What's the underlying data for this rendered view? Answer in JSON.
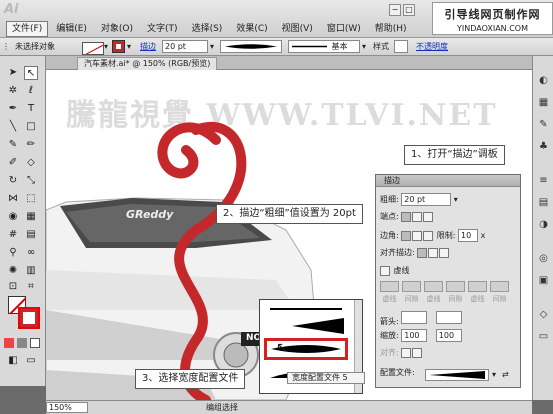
{
  "app": {
    "logo": "Ai"
  },
  "menu": {
    "items": [
      "文件(F)",
      "编辑(E)",
      "对象(O)",
      "文字(T)",
      "选择(S)",
      "效果(C)",
      "视图(V)",
      "窗口(W)",
      "帮助(H)"
    ]
  },
  "watermark_box": {
    "title": "引导线网页制作网",
    "url": "YINDAOXIAN.COM"
  },
  "control_bar": {
    "selection": "未选择对象",
    "stroke_label": "描边",
    "stroke_value": "20 pt",
    "profile": "基本",
    "style_label": "样式",
    "opacity_link": "不透明度"
  },
  "document": {
    "tab": "汽车素材.ai* @ 150% (RGB/预览)",
    "watermark": "騰龍視覺 WWW.TLVI.NET",
    "car_badge": "GReddy",
    "bumper_badge": "NO"
  },
  "stroke_panel": {
    "title": "描边",
    "weight_label": "粗细",
    "weight_value": "20 pt",
    "cap_label": "端点",
    "corner_label": "边角",
    "limit_label": "限制",
    "limit_value": "10",
    "limit_suffix": "x",
    "align_label": "对齐描边",
    "dashed_label": "虚线",
    "dash_labels": [
      "虚线",
      "间隙",
      "虚线",
      "间隙",
      "虚线",
      "间隙"
    ],
    "arrow_label": "箭头",
    "scale_label": "缩放",
    "scale_values": [
      "100",
      "100"
    ],
    "align_row_label": "对齐",
    "profile_label": "配置文件"
  },
  "profile_popup": {
    "footer": "宽度配置文件 5"
  },
  "callouts": {
    "one": "1、打开“描边”调板",
    "two": "2、描边“粗细”值设置为 20pt",
    "three": "3、选择宽度配置文件"
  },
  "status": {
    "zoom": "150%",
    "tool": "编组选择"
  },
  "colors": {
    "accent_red": "#c4282b",
    "highlight_red": "#d42020"
  }
}
